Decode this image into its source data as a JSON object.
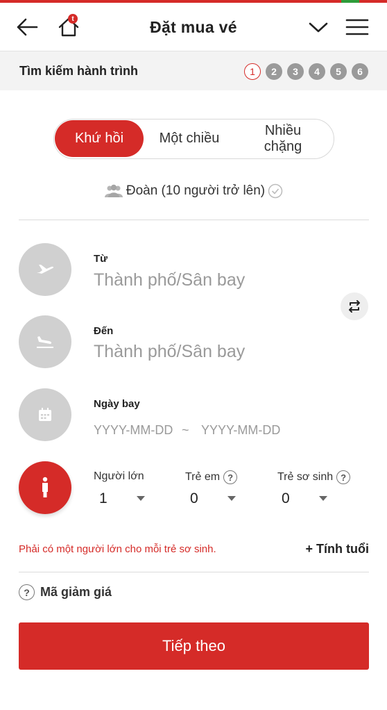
{
  "header": {
    "title": "Đặt mua vé",
    "home_badge": "t"
  },
  "progress": {
    "label": "Tìm kiếm hành trình",
    "steps": [
      "1",
      "2",
      "3",
      "4",
      "5",
      "6"
    ],
    "current_step": "1"
  },
  "trip_type": {
    "options": [
      "Khứ hồi",
      "Một chiều",
      "Nhiều\nchặng"
    ],
    "selected": "Khứ hồi"
  },
  "group_booking": {
    "label": "Đoàn (10 người trở lên)"
  },
  "from": {
    "label": "Từ",
    "placeholder": "Thành phố/Sân bay"
  },
  "to": {
    "label": "Đến",
    "placeholder": "Thành phố/Sân bay"
  },
  "dates": {
    "label": "Ngày bay",
    "depart_placeholder": "YYYY-MM-DD",
    "separator": "~",
    "return_placeholder": "YYYY-MM-DD"
  },
  "passengers": {
    "adult_label": "Người lớn",
    "adult_value": "1",
    "child_label": "Trẻ em",
    "child_value": "0",
    "infant_label": "Trẻ sơ sinh",
    "infant_value": "0",
    "help_glyph": "?"
  },
  "warning": "Phải có một người lớn cho mỗi trẻ sơ sinh.",
  "age_calc": "+ Tính tuổi",
  "promo": {
    "label": "Mã giảm giá",
    "help_glyph": "?"
  },
  "next_button": "Tiếp theo",
  "colors": {
    "brand": "#d52b28",
    "icon_circle": "#d0d0d0",
    "placeholder": "#9a9a9a"
  }
}
